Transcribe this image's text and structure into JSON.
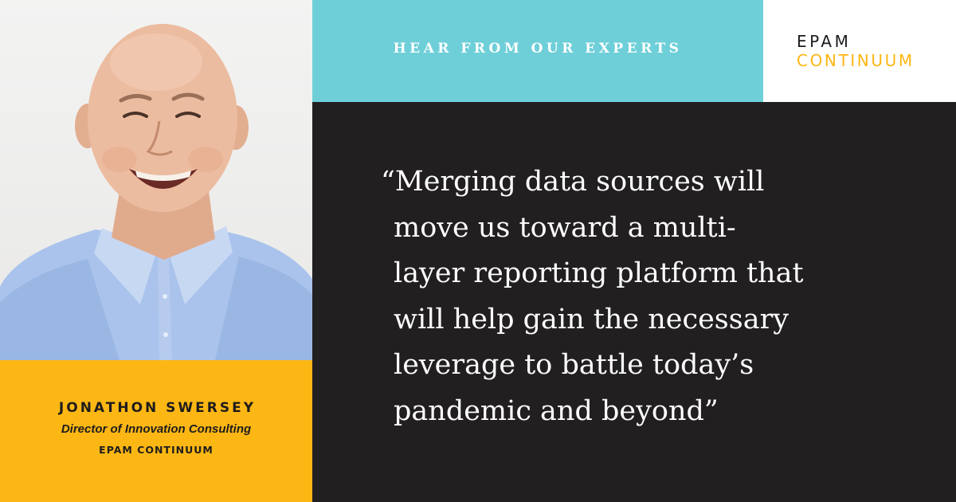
{
  "header": {
    "title": "HEAR FROM OUR EXPERTS"
  },
  "logo": {
    "line1": "EPAM",
    "line2": "CONTINUUM"
  },
  "quote": {
    "lines": [
      "“Merging data sources will",
      "move us toward a multi-",
      "layer reporting platform that",
      "will help gain the necessary",
      "leverage to battle today’s",
      "pandemic and beyond”"
    ]
  },
  "person": {
    "name": "JONATHON SWERSEY",
    "title": "Director of Innovation Consulting",
    "company": "EPAM CONTINUUM"
  },
  "colors": {
    "teal": "#6ecfd8",
    "yellow": "#fdb714",
    "dark": "#221f20",
    "white": "#ffffff"
  }
}
